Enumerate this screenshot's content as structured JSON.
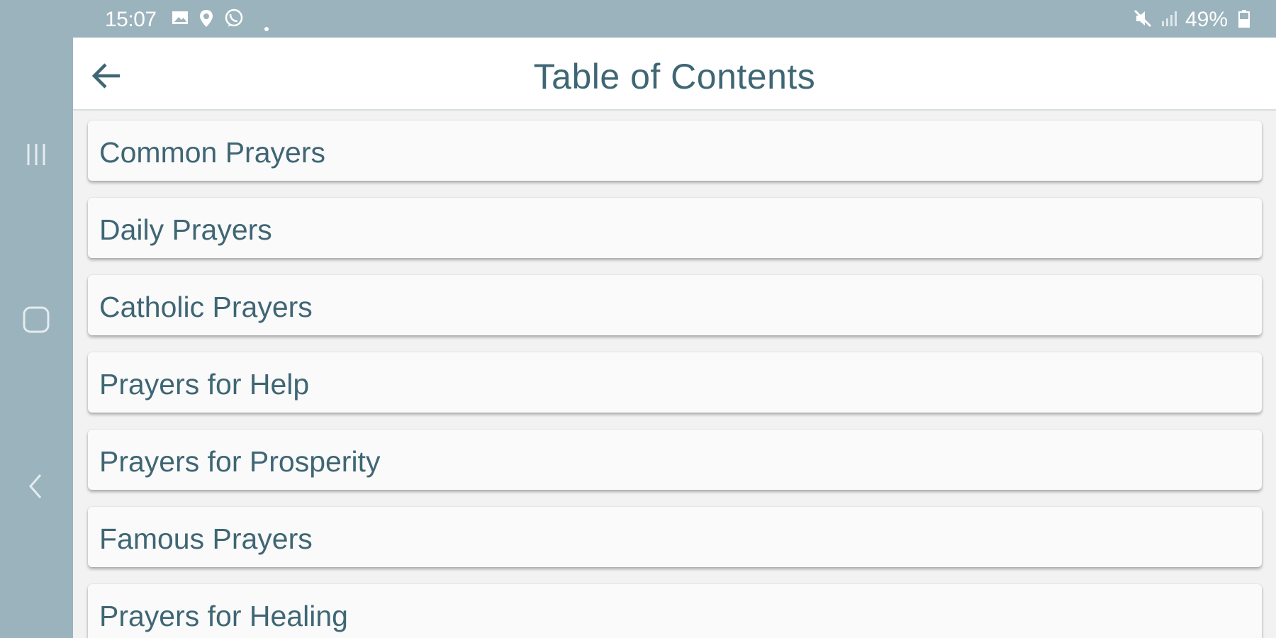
{
  "status_bar": {
    "time": "15:07",
    "left_icons": [
      "image-icon",
      "location-pin-icon",
      "viber-icon",
      "dot-icon"
    ],
    "right_icons": [
      "mute-icon",
      "signal-icon",
      "battery-icon"
    ],
    "battery": "49%"
  },
  "nav": {
    "buttons": [
      "recent-apps-icon",
      "home-icon",
      "back-icon"
    ]
  },
  "toolbar": {
    "back_icon": "arrow-left-icon",
    "title": "Table of Contents"
  },
  "list": {
    "items": [
      {
        "label": "Common Prayers"
      },
      {
        "label": "Daily Prayers"
      },
      {
        "label": "Catholic Prayers"
      },
      {
        "label": "Prayers for Help"
      },
      {
        "label": "Prayers for Prosperity"
      },
      {
        "label": "Famous Prayers"
      },
      {
        "label": "Prayers for Healing"
      }
    ]
  },
  "colors": {
    "system_bg": "#9bb3bd",
    "text": "#3f6674",
    "card": "#fafafa",
    "app_bg": "#f2f2f2"
  }
}
